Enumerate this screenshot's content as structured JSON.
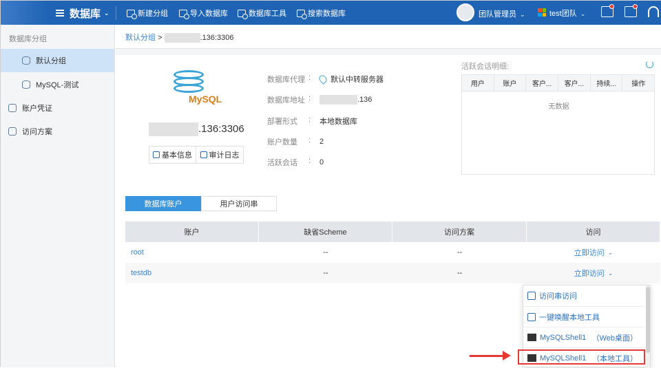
{
  "header": {
    "menu_label": "数据库",
    "buttons": [
      "新建分组",
      "导入数据库",
      "数据库工具",
      "搜索数据库"
    ],
    "user_role": "团队管理员",
    "team_name": "test团队",
    "colors": {
      "bar": "#1e63b4",
      "accent": "#3a95df",
      "alert": "#e53935"
    }
  },
  "sidebar": {
    "title": "数据库分组",
    "items": [
      {
        "label": "默认分组",
        "icon": "database-icon",
        "active": true
      },
      {
        "label": "MySQL-测试",
        "icon": "database-icon",
        "active": false
      },
      {
        "label": "账户凭证",
        "icon": "id-card-icon",
        "active": false
      },
      {
        "label": "访问方案",
        "icon": "document-icon",
        "active": false
      }
    ]
  },
  "breadcrumb": {
    "group": "默认分组",
    "sep": ">",
    "address": ".136:3306"
  },
  "db": {
    "logo_text": "MySQL",
    "address": ".136:3306",
    "tabs": [
      "基本信息",
      "审计日志"
    ],
    "fields": [
      {
        "label": "数据库代理",
        "sep": ":",
        "value": "默认中转服务器"
      },
      {
        "label": "数据库地址",
        "sep": ":",
        "value": ".136"
      },
      {
        "label": "部署形式",
        "sep": ":",
        "value": "本地数据库"
      },
      {
        "label": "账户数量",
        "sep": ":",
        "value": "2"
      },
      {
        "label": "活跃会话",
        "sep": ":",
        "value": "0"
      }
    ]
  },
  "sessions": {
    "title": "活跃会话明细:",
    "columns": [
      "用户",
      "账户",
      "客户...",
      "客户...",
      "持续...",
      "操作"
    ],
    "empty": "无数据"
  },
  "accounts": {
    "tabs": [
      "数据库账户",
      "用户访问串"
    ],
    "columns": [
      "账户",
      "缺省Scheme",
      "访问方案",
      "访问"
    ],
    "rows": [
      {
        "account": "root",
        "scheme": "--",
        "plan": "--",
        "access": "立即访问"
      },
      {
        "account": "testdb",
        "scheme": "--",
        "plan": "--",
        "access": "立即访问"
      }
    ]
  },
  "dropdown": {
    "items": [
      {
        "label": "访问串访问",
        "type": ""
      },
      {
        "label": "一键唤醒本地工具",
        "type": ""
      },
      {
        "label": "MySQLShell1",
        "type": "（Web桌面）"
      },
      {
        "label": "MySQLShell1",
        "type": "（本地工具）"
      }
    ]
  }
}
